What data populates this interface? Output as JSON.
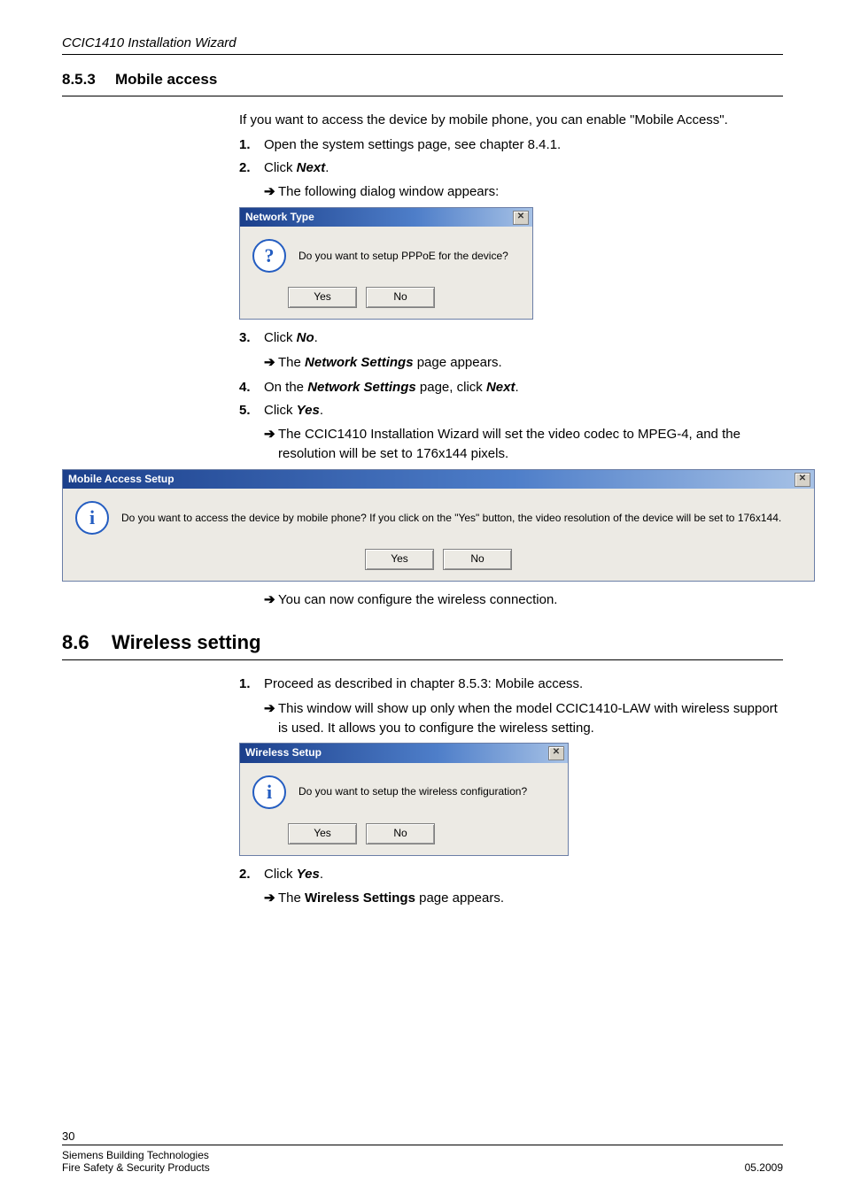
{
  "running_head": "CCIC1410 Installation Wizard",
  "section_853": {
    "number": "8.5.3",
    "title": "Mobile access",
    "intro": "If you want to access the device by mobile phone, you can enable \"Mobile Access\".",
    "step1": "Open the system settings page, see chapter 8.4.1.",
    "step2_prefix": "Click ",
    "step2_bold": "Next",
    "step2_suffix": ".",
    "result2": "The following dialog window appears:",
    "step3_prefix": "Click ",
    "step3_bold": "No",
    "step3_suffix": ".",
    "result3_prefix": "The ",
    "result3_bold": "Network Settings",
    "result3_suffix": " page appears.",
    "step4_prefix": "On the ",
    "step4_bold1": "Network Settings",
    "step4_mid": " page, click ",
    "step4_bold2": "Next",
    "step4_suffix": ".",
    "step5_prefix": "Click ",
    "step5_bold": "Yes",
    "step5_suffix": ".",
    "result5": "The CCIC1410 Installation Wizard will set the video codec to MPEG-4, and the resolution will be set to 176x144 pixels.",
    "result_final": "You can now configure the wireless connection."
  },
  "dlg_network": {
    "title": "Network Type",
    "msg": "Do you want to setup PPPoE for the device?",
    "yes": "Yes",
    "no": "No"
  },
  "dlg_mobile": {
    "title": "Mobile Access Setup",
    "msg": "Do you want to access the device by mobile phone? If you click on the \"Yes\" button, the video resolution of the device will be set to 176x144.",
    "yes": "Yes",
    "no": "No"
  },
  "section_86": {
    "number": "8.6",
    "title": "Wireless setting",
    "step1": "Proceed as described in chapter 8.5.3: Mobile access.",
    "result1": "This window will show up only when the model CCIC1410-LAW with wireless support is used. It allows you to configure the wireless setting.",
    "step2_prefix": "Click ",
    "step2_bold": "Yes",
    "step2_suffix": ".",
    "result2_prefix": "The ",
    "result2_bold": "Wireless Settings",
    "result2_suffix": " page appears."
  },
  "dlg_wireless": {
    "title": "Wireless Setup",
    "msg": "Do you want to setup the wireless configuration?",
    "yes": "Yes",
    "no": "No"
  },
  "footer": {
    "page": "30",
    "left1": "Siemens Building Technologies",
    "left2": "Fire Safety & Security Products",
    "right": "05.2009"
  },
  "glyphs": {
    "arrow": "➔",
    "close": "✕"
  }
}
